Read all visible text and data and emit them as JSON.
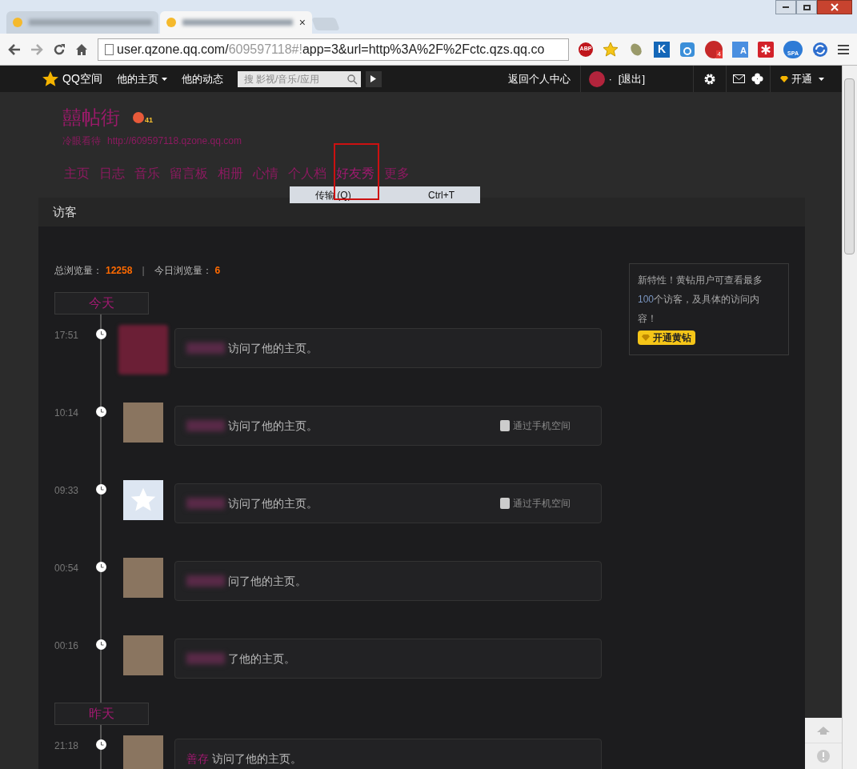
{
  "browser": {
    "tabs": [
      {
        "selected": false
      },
      {
        "selected": true,
        "close": "×"
      }
    ],
    "address": {
      "host": "user.qzone.qq.com/",
      "faded": "609597118#!",
      "rest": "app=3&url=http%3A%2F%2Fctc.qzs.qq.co"
    },
    "extensions": [
      {
        "kind": "abp",
        "label": "ABP"
      },
      {
        "kind": "star"
      },
      {
        "kind": "leaf"
      },
      {
        "kind": "k",
        "label": "K"
      },
      {
        "kind": "ring"
      },
      {
        "kind": "badge",
        "label": "4"
      },
      {
        "kind": "translate",
        "label": "A"
      },
      {
        "kind": "asterisk"
      },
      {
        "kind": "spa",
        "label": "SPA"
      },
      {
        "kind": "refresh"
      }
    ]
  },
  "topbar": {
    "logo": "QQ空间",
    "menu": [
      {
        "label": "他的主页",
        "dropdown": true
      },
      {
        "label": "他的动态",
        "dropdown": false
      }
    ],
    "search": {
      "placeholder": "搜 影视/音乐/应用"
    },
    "back": "返回个人中心",
    "dot": "·",
    "logout": "[退出]",
    "vip": "开通"
  },
  "profile": {
    "name": "囍帖街",
    "level": "41",
    "motto": "冷眼看待",
    "url": "http://609597118.qzone.qq.com"
  },
  "nav": [
    {
      "label": "主页",
      "selected": false
    },
    {
      "label": "日志",
      "selected": false
    },
    {
      "label": "音乐",
      "selected": false
    },
    {
      "label": "留言板",
      "selected": false
    },
    {
      "label": "相册",
      "selected": false
    },
    {
      "label": "心情",
      "selected": false
    },
    {
      "label": "个人档",
      "selected": false
    },
    {
      "label": "好友秀",
      "selected": true
    },
    {
      "label": "更多",
      "selected": false
    }
  ],
  "context_menu": {
    "item": "传输 (Q)",
    "shortcut": "Ctrl+T"
  },
  "panel": {
    "title": "访客",
    "stats": {
      "total_label": "总浏览量：",
      "total": "12258",
      "sep": "|",
      "today_label": "今日浏览量：",
      "today": "6"
    },
    "groups": [
      {
        "label": "今天",
        "visits": [
          {
            "kind": "blurred",
            "time": "17:51",
            "name_blurred": true,
            "action": "访问了他的主页。"
          },
          {
            "kind": "photo",
            "time": "10:14",
            "name_blurred": true,
            "action": "访问了他的主页。",
            "via": "通过手机空间"
          },
          {
            "kind": "default",
            "time": "09:33",
            "name_blurred": true,
            "action": "访问了他的主页。",
            "via": "通过手机空间"
          },
          {
            "kind": "photo",
            "time": "00:54",
            "name_blurred": true,
            "action": "问了他的主页。"
          },
          {
            "kind": "photo",
            "time": "00:16",
            "name_blurred": true,
            "action": "了他的主页。"
          }
        ]
      },
      {
        "label": "昨天",
        "visits": [
          {
            "kind": "photo",
            "time": "21:18",
            "name": "善存",
            "action": "访问了他的主页。"
          }
        ]
      }
    ],
    "promo": {
      "before": "新特性！黄钻用户可查看最多",
      "highlight": "100",
      "after": "个访客，及具体的访问内容！",
      "button": "开通黄钻"
    }
  }
}
